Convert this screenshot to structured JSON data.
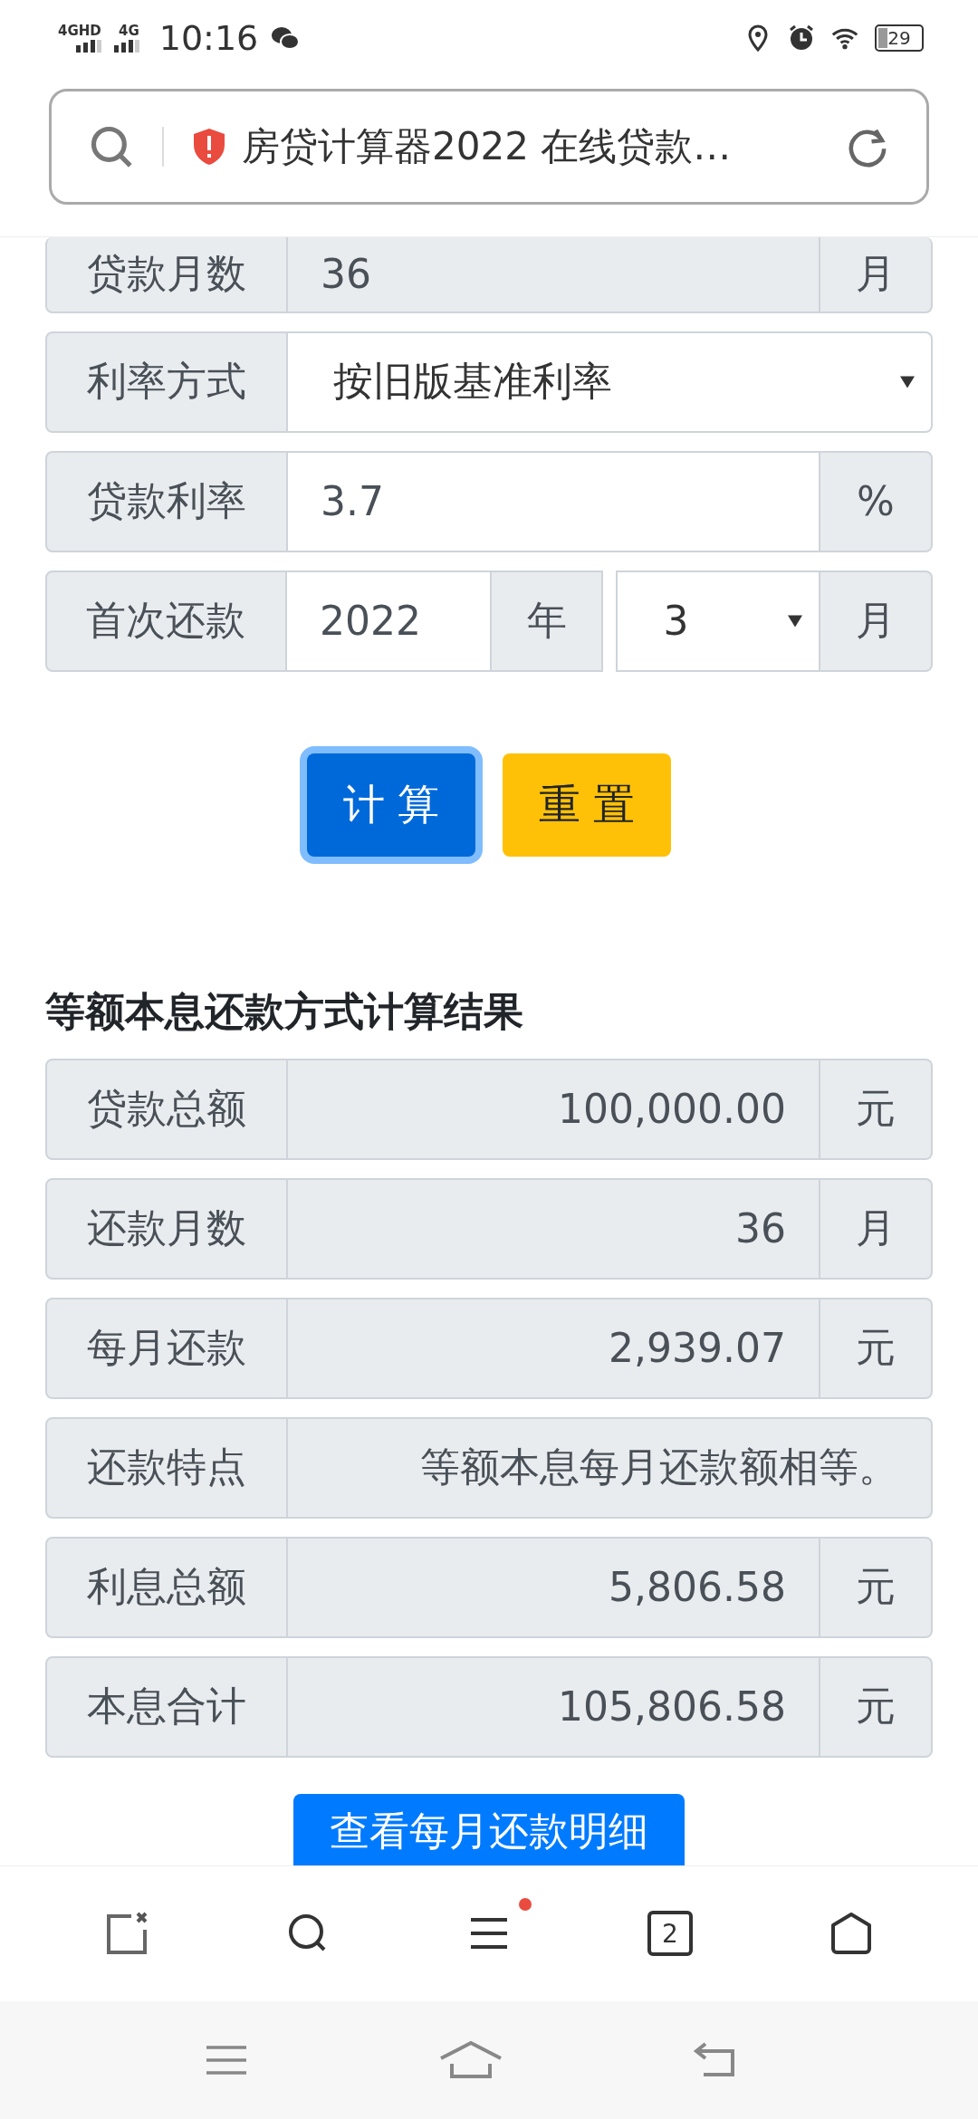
{
  "status_bar": {
    "network_1": "4GHD",
    "network_2": "4G",
    "time": "10:16",
    "battery": "29"
  },
  "address_bar": {
    "title": "房贷计算器2022 在线贷款…"
  },
  "form_rows": [
    {
      "kind": "readonly",
      "label": "贷款月数",
      "value": "36",
      "unit": "月"
    },
    {
      "kind": "select",
      "label": "利率方式",
      "value": "按旧版基准利率"
    },
    {
      "kind": "input",
      "label": "贷款利率",
      "value": "3.7",
      "unit": "%"
    },
    {
      "kind": "date",
      "label": "首次还款",
      "year": "2022",
      "year_unit": "年",
      "month": "3",
      "month_unit": "月"
    }
  ],
  "buttons": [
    {
      "label": "计 算",
      "kind": "primary",
      "focused": true
    },
    {
      "label": "重 置",
      "kind": "warning",
      "focused": false
    }
  ],
  "results": {
    "title": "等额本息还款方式计算结果",
    "rows": [
      {
        "label": "贷款总额",
        "value": "100,000.00",
        "unit": "元"
      },
      {
        "label": "还款月数",
        "value": "36",
        "unit": "月"
      },
      {
        "label": "每月还款",
        "value": "2,939.07",
        "unit": "元"
      },
      {
        "label": "还款特点",
        "value": "等额本息每月还款额相等。"
      },
      {
        "label": "利息总额",
        "value": "5,806.58",
        "unit": "元"
      },
      {
        "label": "本息合计",
        "value": "105,806.58",
        "unit": "元"
      }
    ]
  },
  "detail_button": "查看每月还款明细",
  "toolbar": {
    "tab_count": "2",
    "menu_badge": true
  }
}
